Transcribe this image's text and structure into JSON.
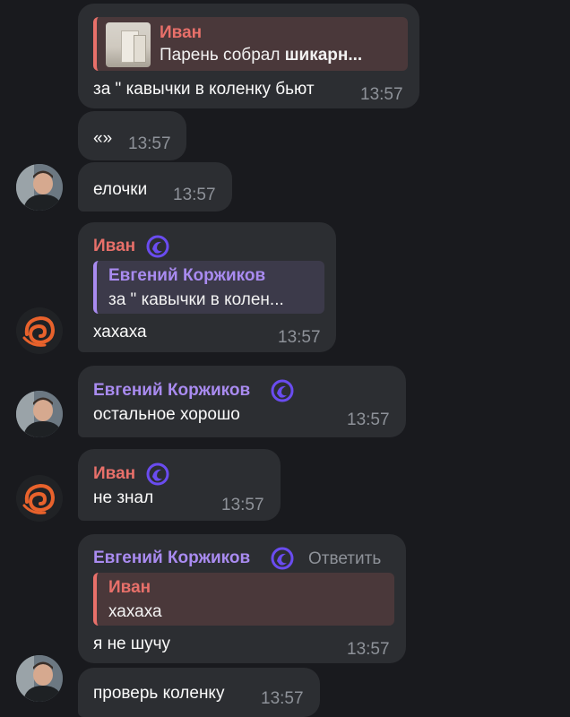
{
  "messages": [
    {
      "reply_name": "Иван",
      "reply_text_plain": "Парень собрал ",
      "reply_text_bold": "шикарн...",
      "text": "за \" кавычки в коленку бьют",
      "time": "13:57"
    },
    {
      "text": "«»",
      "time": "13:57"
    },
    {
      "text": "елочки",
      "time": "13:57"
    },
    {
      "author": "Иван",
      "reply_name": "Евгений Коржиков",
      "reply_text": "за \" кавычки в колен...",
      "text": "хахаха",
      "time": "13:57"
    },
    {
      "author": "Евгений Коржиков",
      "text": "остальное хорошо",
      "time": "13:57"
    },
    {
      "author": "Иван",
      "text": "не знал",
      "time": "13:57"
    },
    {
      "author": "Евгений Коржиков",
      "reply_action": "Ответить",
      "reply_name": "Иван",
      "reply_text": "хахаха",
      "text": "я не шучу",
      "time": "13:57"
    },
    {
      "text": "проверь коленку",
      "time": "13:57"
    }
  ],
  "colors": {
    "background": "#191a1e",
    "bubble": "#2c2e32",
    "name_red": "#e8706a",
    "name_purple": "#a98bf0",
    "time": "#8e9299",
    "status_emoji": "#6a4cf0",
    "logo_orange": "#e8622c"
  }
}
